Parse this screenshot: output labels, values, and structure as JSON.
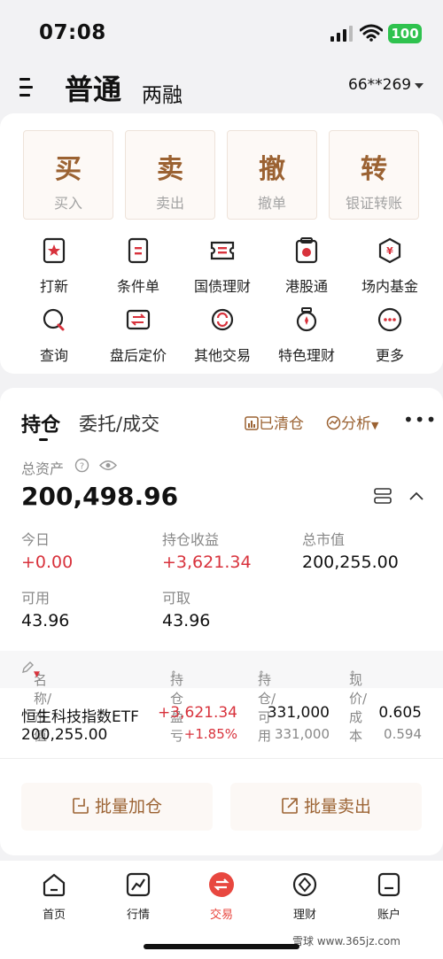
{
  "status_bar": {
    "time": "07:08",
    "battery": "100"
  },
  "header": {
    "tab_main": "普通",
    "tab_sub": "两融",
    "account": "66**269"
  },
  "trade_buttons": [
    {
      "big": "买",
      "small": "买入"
    },
    {
      "big": "卖",
      "small": "卖出"
    },
    {
      "big": "撤",
      "small": "撤单"
    },
    {
      "big": "转",
      "small": "银证转账"
    }
  ],
  "functions_row1": [
    {
      "label": "打新",
      "icon": "new-stock-icon"
    },
    {
      "label": "条件单",
      "icon": "condition-order-icon"
    },
    {
      "label": "国债理财",
      "icon": "bond-ticket-icon"
    },
    {
      "label": "港股通",
      "icon": "hk-connect-icon"
    },
    {
      "label": "场内基金",
      "icon": "exchange-fund-icon"
    }
  ],
  "functions_row2": [
    {
      "label": "查询",
      "icon": "query-icon"
    },
    {
      "label": "盘后定价",
      "icon": "after-hours-icon"
    },
    {
      "label": "其他交易",
      "icon": "other-trade-icon"
    },
    {
      "label": "特色理财",
      "icon": "featured-finance-icon"
    },
    {
      "label": "更多",
      "icon": "more-icon"
    }
  ],
  "holdings": {
    "tab_positions": "持仓",
    "tab_orders": "委托/成交",
    "cleared": "已清仓",
    "analysis": "分析",
    "total_assets_label": "总资产",
    "total_assets": "200,498.96",
    "today_label": "今日",
    "today_value": "+0.00",
    "pnl_label": "持仓收益",
    "pnl_value": "+3,621.34",
    "market_value_label": "总市值",
    "market_value": "200,255.00",
    "available_label": "可用",
    "available_value": "43.96",
    "withdrawable_label": "可取",
    "withdrawable_value": "43.96",
    "columns": [
      "名称/市值",
      "持仓盈亏",
      "持仓/可用",
      "现价/成本"
    ],
    "row": {
      "name": "恒生科技指数ETF",
      "market_value": "200,255.00",
      "pnl": "+3,621.34",
      "pnl_pct": "+1.85%",
      "position": "331,000",
      "available": "331,000",
      "price": "0.605",
      "cost": "0.594"
    },
    "batch_add": "批量加仓",
    "batch_sell": "批量卖出"
  },
  "tabbar": [
    {
      "label": "首页",
      "icon": "home-icon"
    },
    {
      "label": "行情",
      "icon": "market-icon"
    },
    {
      "label": "交易",
      "icon": "trade-icon"
    },
    {
      "label": "理财",
      "icon": "wealth-icon"
    },
    {
      "label": "账户",
      "icon": "account-icon"
    }
  ],
  "watermark": "雪球 www.365jz.com",
  "colors": {
    "accent": "#9b6232",
    "red": "#d8323c",
    "tab_active": "#e8473f"
  }
}
